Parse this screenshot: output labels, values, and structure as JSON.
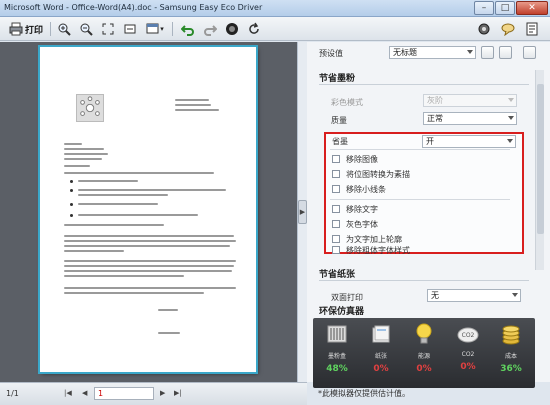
{
  "window": {
    "title": "Microsoft Word - Office-Word(A4).doc - Samsung Easy Eco Driver",
    "minimize": "–",
    "maximize": "□",
    "close": "✕"
  },
  "toolbar": {
    "print_label": "打印",
    "icons": [
      "print-icon",
      "zoom-in-icon",
      "zoom-out-icon",
      "fit-page-icon",
      "fit-width-icon",
      "view-mode-icon",
      "undo-icon",
      "redo-icon",
      "stop-icon",
      "refresh-icon",
      "settings-icon",
      "help-icon",
      "info-icon"
    ]
  },
  "preset": {
    "label": "预设值",
    "value": "无标题"
  },
  "toner_save": {
    "section_title": "节省墨粉",
    "color_mode": {
      "label": "彩色模式",
      "value": "灰阶"
    },
    "quality": {
      "label": "质量",
      "value": "正常"
    },
    "save": {
      "label": "省墨",
      "value": "开"
    },
    "options": [
      "移除图像",
      "将位图转换为素描",
      "移除小线条",
      "移除文字",
      "灰色字体",
      "为文字加上轮廓",
      "移除粗体字体样式"
    ]
  },
  "paper_save": {
    "section_title": "节省纸张",
    "duplex": {
      "label": "双面打印",
      "value": "无"
    }
  },
  "eco": {
    "section_title": "环保仿真器",
    "items": [
      {
        "name": "墨粉盒",
        "value": "48%",
        "color": "#5fd35f"
      },
      {
        "name": "纸张",
        "value": "0%",
        "color": "#e04040"
      },
      {
        "name": "能源",
        "value": "0%",
        "color": "#e04040"
      },
      {
        "name": "CO2",
        "value": "0%",
        "color": "#e04040"
      },
      {
        "name": "成本",
        "value": "36%",
        "color": "#5fd35f"
      }
    ],
    "note": "*此模拟器仅提供估计值。"
  },
  "status": {
    "page_count": "1/1",
    "first": "|◀",
    "prev": "◀",
    "current_page": "1",
    "next": "▶",
    "last": "▶|"
  },
  "colors": {
    "highlight": "#d81e1e",
    "accent": "#3aa7c9"
  }
}
